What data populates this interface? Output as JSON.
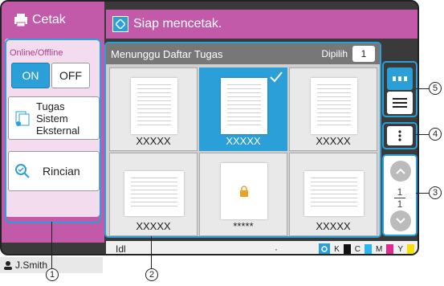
{
  "side": {
    "title": "Cetak",
    "mode_label": "Online/Offline",
    "on_label": "ON",
    "off_label": "OFF",
    "external_label": "Tugas\nSistem\nEksternal",
    "detail_label": "Rincian",
    "user": "J.Smith"
  },
  "header": {
    "status": "Siap mencetak."
  },
  "list": {
    "title": "Menunggu Daftar Tugas",
    "selected_label": "Dipilih",
    "selected_count": "1",
    "tiles": [
      {
        "name": "XXXXX",
        "selected": false
      },
      {
        "name": "XXXXX",
        "selected": true
      },
      {
        "name": "XXXXX",
        "selected": false
      },
      {
        "name": "XXXXX",
        "selected": false
      },
      {
        "name": "*****",
        "selected": false,
        "locked": true
      },
      {
        "name": "XXXXX",
        "selected": false
      }
    ]
  },
  "pagination": {
    "current": "1",
    "total": "1"
  },
  "statusbar": {
    "text": "Idl",
    "dot": "·"
  },
  "ink": {
    "k": "K",
    "c": "C",
    "m": "M",
    "y": "Y"
  },
  "callouts": {
    "c1": "1",
    "c2": "2",
    "c3": "3",
    "c4": "4",
    "c5": "5"
  }
}
